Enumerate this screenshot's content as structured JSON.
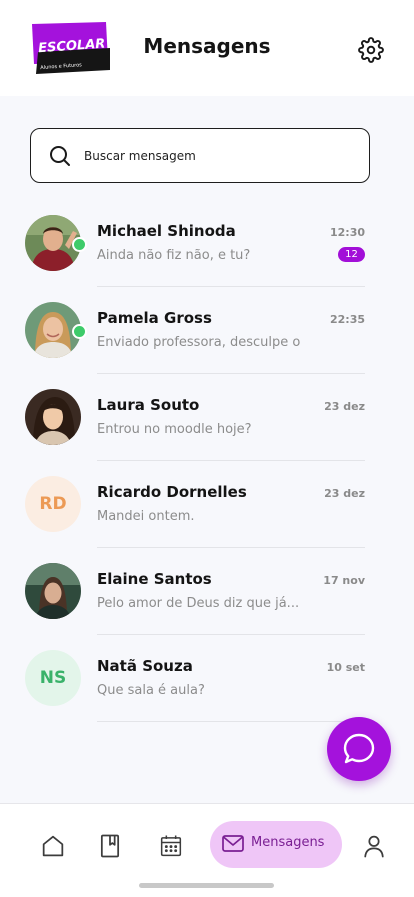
{
  "app": {
    "logo_text": "ESCOLAR",
    "logo_subtext": "Alunos e Futuros"
  },
  "header": {
    "title": "Mensagens",
    "settings_icon": "gear-icon"
  },
  "search": {
    "placeholder": "Buscar mensagem",
    "value": "",
    "icon": "search-icon"
  },
  "conversations": [
    {
      "name": "Michael Shinoda",
      "preview": "Ainda não fiz não, e tu?",
      "time": "12:30",
      "unread": "12",
      "online": true,
      "avatar": "photo"
    },
    {
      "name": "Pamela Gross",
      "preview": "Enviado professora, desculpe o",
      "time": "22:35",
      "online": true,
      "avatar": "photo"
    },
    {
      "name": "Laura Souto",
      "preview": "Entrou no moodle hoje?",
      "time": "23 dez",
      "online": false,
      "avatar": "photo"
    },
    {
      "name": "Ricardo Dornelles",
      "preview": "Mandei ontem.",
      "time": "23 dez",
      "online": false,
      "avatar": "initials",
      "initials": "RD"
    },
    {
      "name": "Elaine Santos",
      "preview": "Pelo amor de Deus diz que já...",
      "time": "17 nov",
      "online": false,
      "avatar": "photo"
    },
    {
      "name": "Natã Souza",
      "preview": "Que sala é aula?",
      "time": "10 set",
      "online": false,
      "avatar": "initials",
      "initials": "NS"
    }
  ],
  "fab": {
    "icon": "chat-bubble-icon"
  },
  "bottom_nav": {
    "items": [
      {
        "icon": "home-icon"
      },
      {
        "icon": "book-icon"
      },
      {
        "icon": "calendar-icon"
      },
      {
        "icon": "mail-icon",
        "label": "Mensagens",
        "active": true
      },
      {
        "icon": "user-icon"
      }
    ]
  },
  "colors": {
    "accent": "#a412dc",
    "badge": "#a20fd8",
    "active_nav_bg": "#efc6f7",
    "online": "#3ecb6a"
  }
}
